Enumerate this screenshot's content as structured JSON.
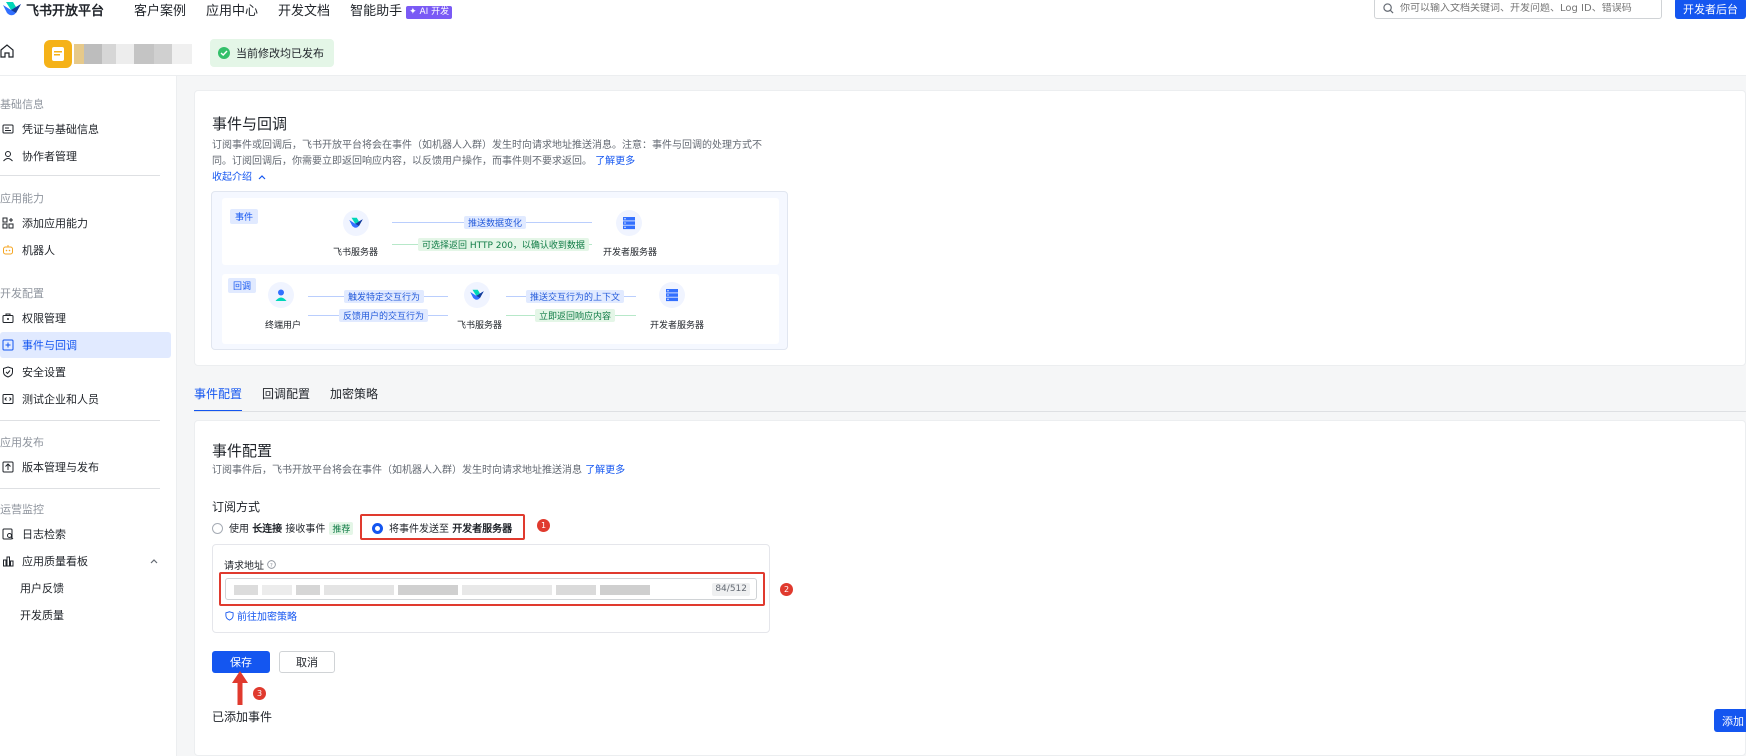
{
  "topnav": {
    "brand": "飞书开放平台",
    "links": [
      "客户案例",
      "应用中心",
      "开发文档",
      "智能助手"
    ],
    "ai_badge": "AI 开发",
    "search_placeholder": "你可以输入文档关键词、开发问题、Log ID、错误码",
    "dev_console": "开发者后台"
  },
  "appbar": {
    "status": "当前修改均已发布"
  },
  "sidebar": {
    "groups": {
      "basic": "基础信息",
      "capability": "应用能力",
      "dev": "开发配置",
      "release": "应用发布",
      "monitor": "运营监控"
    },
    "items": {
      "credentials": "凭证与基础信息",
      "collaborators": "协作者管理",
      "add_capability": "添加应用能力",
      "bot": "机器人",
      "permissions": "权限管理",
      "events": "事件与回调",
      "security": "安全设置",
      "test_users": "测试企业和人员",
      "versions": "版本管理与发布",
      "logs": "日志检索",
      "quality": "应用质量看板",
      "feedback": "用户反馈",
      "dev_quality": "开发质量"
    }
  },
  "intro": {
    "title": "事件与回调",
    "desc_line1": "订阅事件或回调后，飞书开放平台将会在事件（如机器人入群）发生时向请求地址推送消息。注意：事件与回调的处理方式不",
    "desc_line2": "同。订阅回调后，你需要立即返回响应内容，以反馈用户操作，而事件则不要求返回。",
    "learn_more": "了解更多",
    "collapse": "收起介绍"
  },
  "diagram": {
    "event_tag": "事件",
    "callback_tag": "回调",
    "feishu_server": "飞书服务器",
    "dev_server": "开发者服务器",
    "end_user": "终端用户",
    "push_change": "推送数据变化",
    "return_200": "可选择返回 HTTP 200，以确认收到数据",
    "trigger_action": "触发特定交互行为",
    "feedback_action": "反馈用户的交互行为",
    "push_context": "推送交互行为的上下文",
    "return_response": "立即返回响应内容"
  },
  "tabs": [
    "事件配置",
    "回调配置",
    "加密策略"
  ],
  "event_config": {
    "title": "事件配置",
    "desc": "订阅事件后，飞书开放平台将会在事件（如机器人入群）发生时向请求地址推送消息",
    "learn_more": "了解更多",
    "subscribe_label": "订阅方式",
    "option_long_prefix": "使用",
    "option_long_bold": "长连接",
    "option_long_suffix": "接收事件",
    "recommend": "推荐",
    "option_server_prefix": "将事件发送至",
    "option_server_bold": "开发者服务器",
    "request_url_label": "请求地址",
    "counter": "84/512",
    "encrypt_link": "前往加密策略",
    "save": "保存",
    "cancel": "取消",
    "added_events": "已添加事件",
    "add": "添加"
  },
  "annotations": [
    "1",
    "2",
    "3"
  ],
  "colors": {
    "primary": "#1456f0",
    "annotation": "#e03a2e",
    "success": "#34c06a"
  }
}
